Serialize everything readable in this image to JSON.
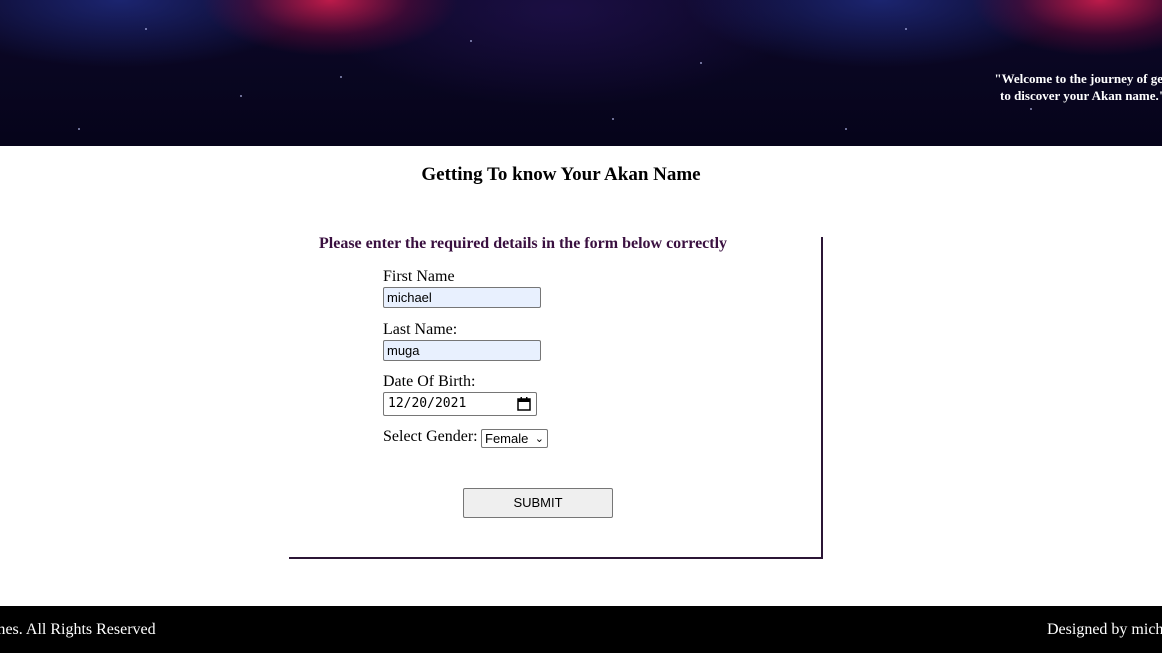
{
  "header": {
    "welcome_line1": "\"Welcome to the journey of gett",
    "welcome_line2": "to discover your Akan name.\""
  },
  "page_title": "Getting To know Your Akan Name",
  "form": {
    "instructions": "Please enter the required details in the form below correctly",
    "first_name_label": "First Name",
    "first_name_value": "michael",
    "last_name_label": "Last Name:",
    "last_name_value": "muga",
    "dob_label": "Date Of Birth:",
    "dob_value": "12/20/2021",
    "gender_label": "Select Gender:",
    "gender_value": "Female",
    "submit_label": "SUBMIT"
  },
  "footer": {
    "left_text": "mes. All Rights Reserved",
    "right_text": "Designed by mich"
  },
  "colors": {
    "banner": "#0c0828",
    "instruction_text": "#3a1040",
    "input_autofill": "#e8f0fe",
    "footer": "#000000"
  }
}
